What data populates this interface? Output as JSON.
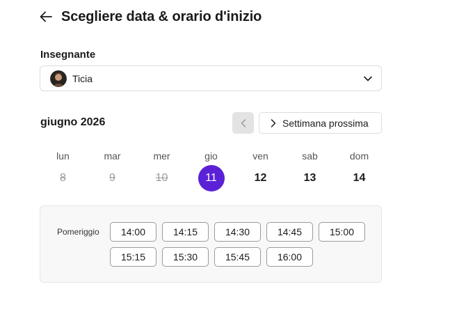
{
  "header": {
    "title": "Scegliere data & orario d'inizio",
    "back_icon": "arrow-left-icon"
  },
  "teacher": {
    "label": "Insegnante",
    "selected": "Ticia",
    "avatar_icon": "teacher-avatar",
    "dropdown_icon": "chevron-down-icon"
  },
  "calendar": {
    "month": "giugno 2026",
    "prev_icon": "chevron-left-icon",
    "next_icon": "chevron-right-icon",
    "next_label": "Settimana prossima",
    "days": [
      {
        "dow": "lun",
        "date": "8",
        "state": "past"
      },
      {
        "dow": "mar",
        "date": "9",
        "state": "past"
      },
      {
        "dow": "mer",
        "date": "10",
        "state": "past"
      },
      {
        "dow": "gio",
        "date": "11",
        "state": "selected"
      },
      {
        "dow": "ven",
        "date": "12",
        "state": "available"
      },
      {
        "dow": "sab",
        "date": "13",
        "state": "available"
      },
      {
        "dow": "dom",
        "date": "14",
        "state": "available"
      }
    ]
  },
  "slots": {
    "period": "Pomeriggio",
    "times": [
      "14:00",
      "14:15",
      "14:30",
      "14:45",
      "15:00",
      "15:15",
      "15:30",
      "15:45",
      "16:00"
    ]
  },
  "colors": {
    "accent": "#5b21d6",
    "disabled_bg": "#e3e3e3",
    "panel_bg": "#f8f8f8",
    "text": "#1a1a1a",
    "muted": "#9b9b9b"
  }
}
